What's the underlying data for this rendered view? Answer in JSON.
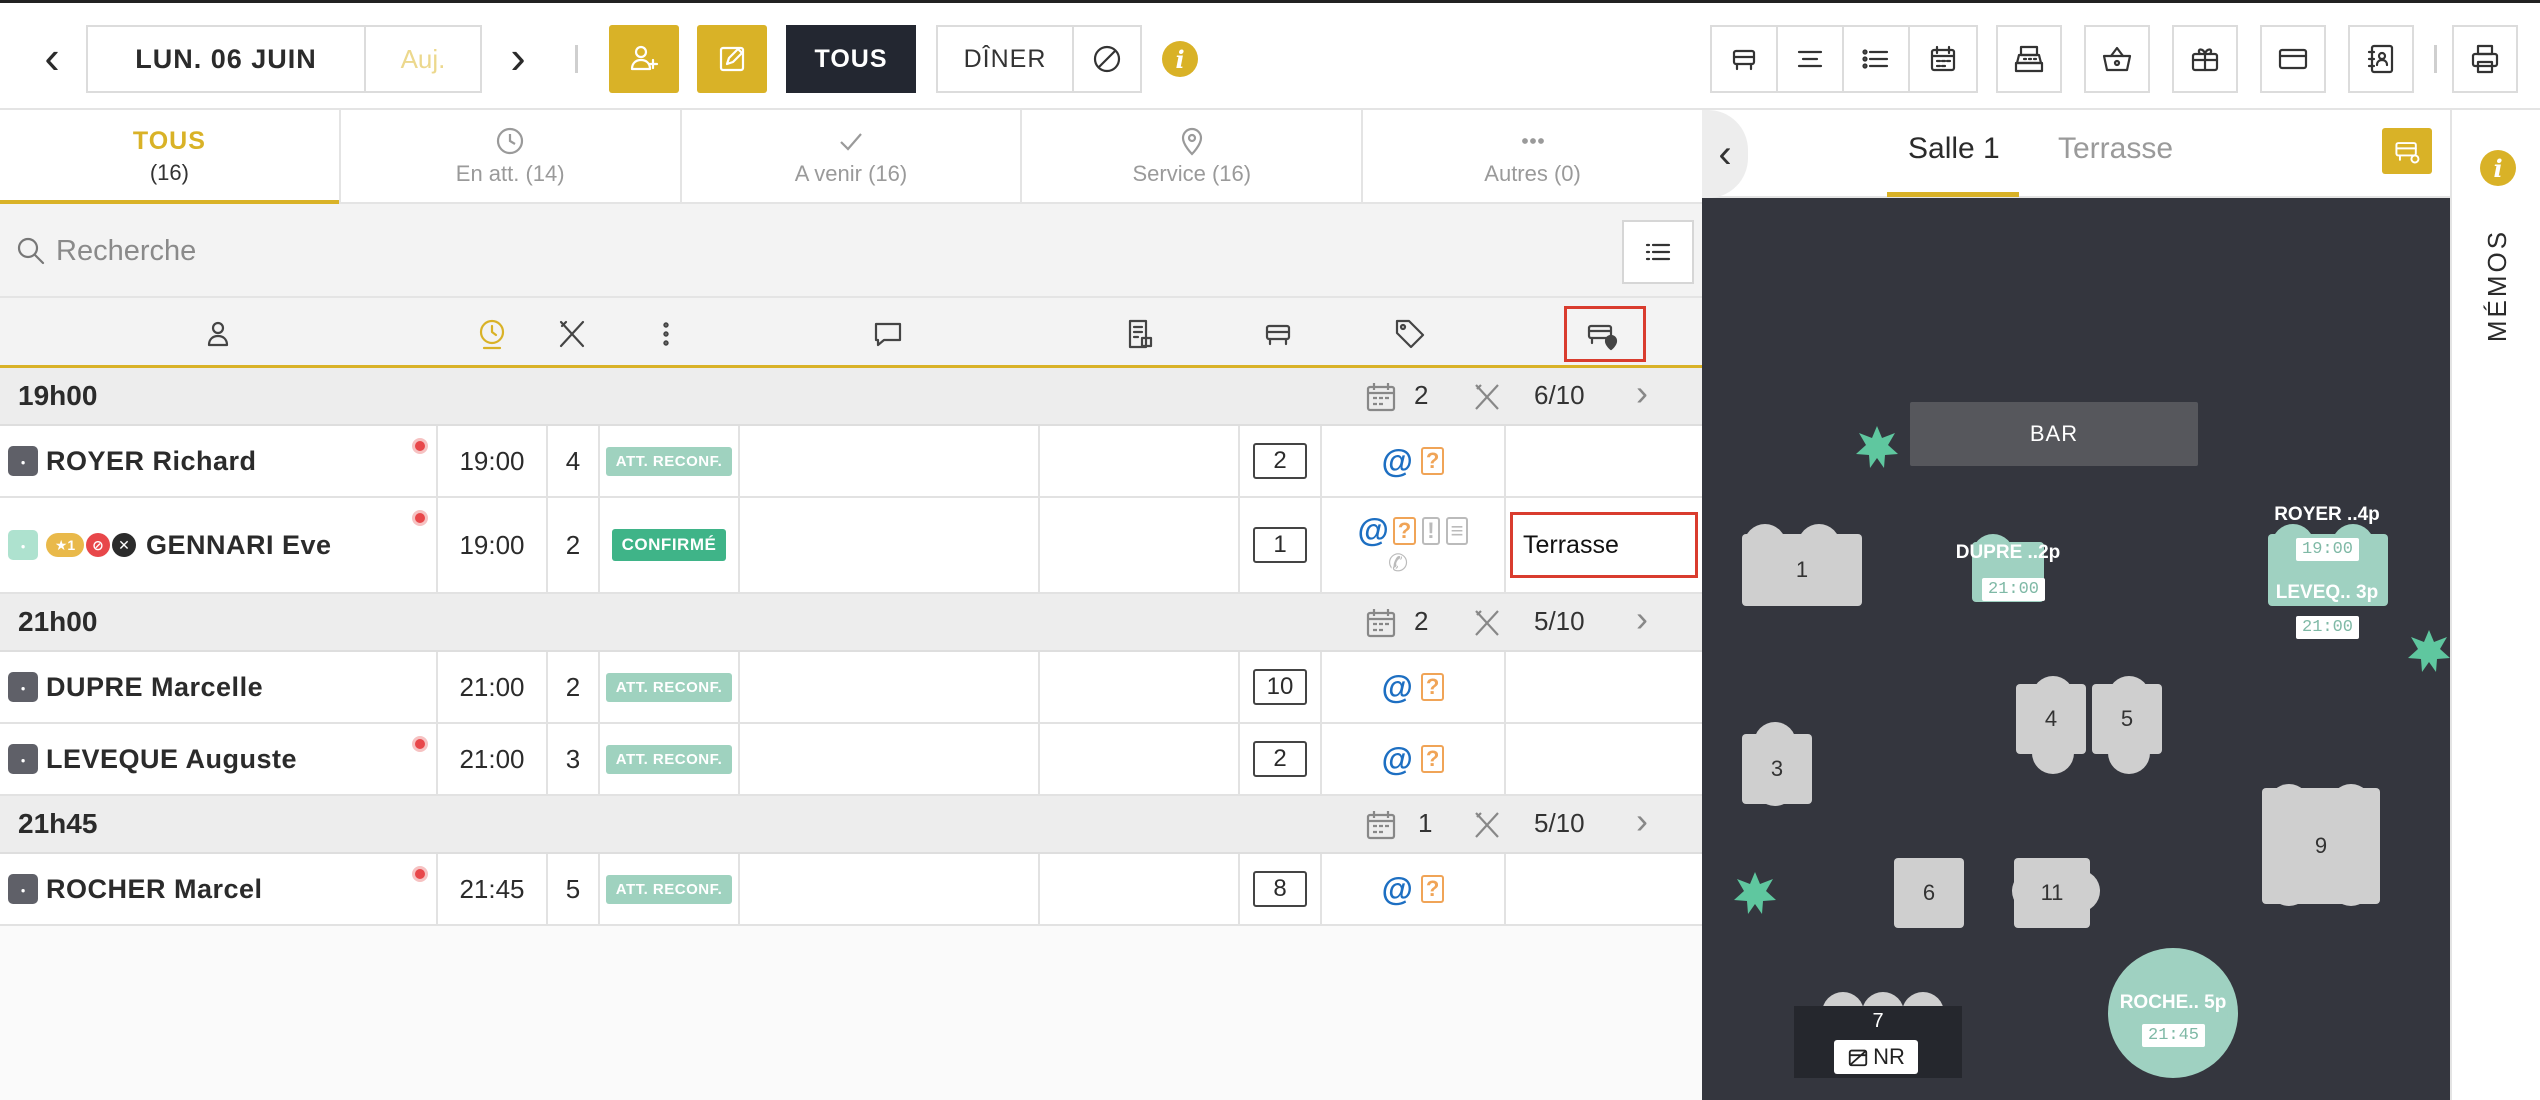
{
  "topbar": {
    "date": "LUN. 06 JUIN",
    "today": "Auj.",
    "filter_all": "TOUS",
    "service": "DÎNER",
    "info": "i",
    "icons": [
      "prev-day-icon",
      "next-day-icon",
      "add-user-icon",
      "edit-icon",
      "block-icon",
      "tables-icon",
      "timeline-icon",
      "list-icon",
      "calendar-icon",
      "cash-register-icon",
      "basket-icon",
      "gift-icon",
      "card-icon",
      "contacts-icon",
      "print-icon"
    ]
  },
  "tabs": [
    {
      "label": "TOUS",
      "count": "(16)"
    },
    {
      "label": "En att. (14)"
    },
    {
      "label": "A venir (16)"
    },
    {
      "label": "Service (16)"
    },
    {
      "label": "Autres (0)"
    }
  ],
  "search": {
    "placeholder": "Recherche"
  },
  "groups": [
    {
      "time": "19h00",
      "bookings": "2",
      "covers": "6/10"
    },
    {
      "time": "21h00",
      "bookings": "2",
      "covers": "5/10"
    },
    {
      "time": "21h45",
      "bookings": "1",
      "covers": "5/10"
    }
  ],
  "reservations": [
    {
      "name": "ROYER Richard",
      "time": "19:00",
      "pax": "4",
      "status": "ATT. RECONF.",
      "table": "2",
      "zone": ""
    },
    {
      "name": "GENNARI Eve",
      "time": "19:00",
      "pax": "2",
      "status": "CONFIRMÉ",
      "table": "1",
      "zone": "Terrasse",
      "badge_count": "1"
    },
    {
      "name": "DUPRE Marcelle",
      "time": "21:00",
      "pax": "2",
      "status": "ATT. RECONF.",
      "table": "10",
      "zone": ""
    },
    {
      "name": "LEVEQUE Auguste",
      "time": "21:00",
      "pax": "3",
      "status": "ATT. RECONF.",
      "table": "2",
      "zone": ""
    },
    {
      "name": "ROCHER Marcel",
      "time": "21:45",
      "pax": "5",
      "status": "ATT. RECONF.",
      "table": "8",
      "zone": ""
    }
  ],
  "plan": {
    "rooms": [
      "Salle 1",
      "Terrasse"
    ],
    "bar": "BAR",
    "tables": [
      "1",
      "3",
      "4",
      "5",
      "6",
      "9",
      "11",
      "7"
    ],
    "labels": [
      {
        "text": "DUPRE ..2p",
        "time": "21:00"
      },
      {
        "text": "ROYER ..4p",
        "time": "19:00"
      },
      {
        "text": "LEVEQ.. 3p",
        "time": "21:00"
      },
      {
        "text": "ROCHE.. 5p",
        "time": "21:45"
      }
    ],
    "nr": "NR"
  },
  "memos": {
    "label": "MÉMOS"
  },
  "colors": {
    "accent": "#d9b227",
    "dark": "#232731",
    "confirmed": "#3fb488",
    "pending": "#9fd2bf",
    "alert": "#d93c2e",
    "plan_bg": "#34363e"
  }
}
